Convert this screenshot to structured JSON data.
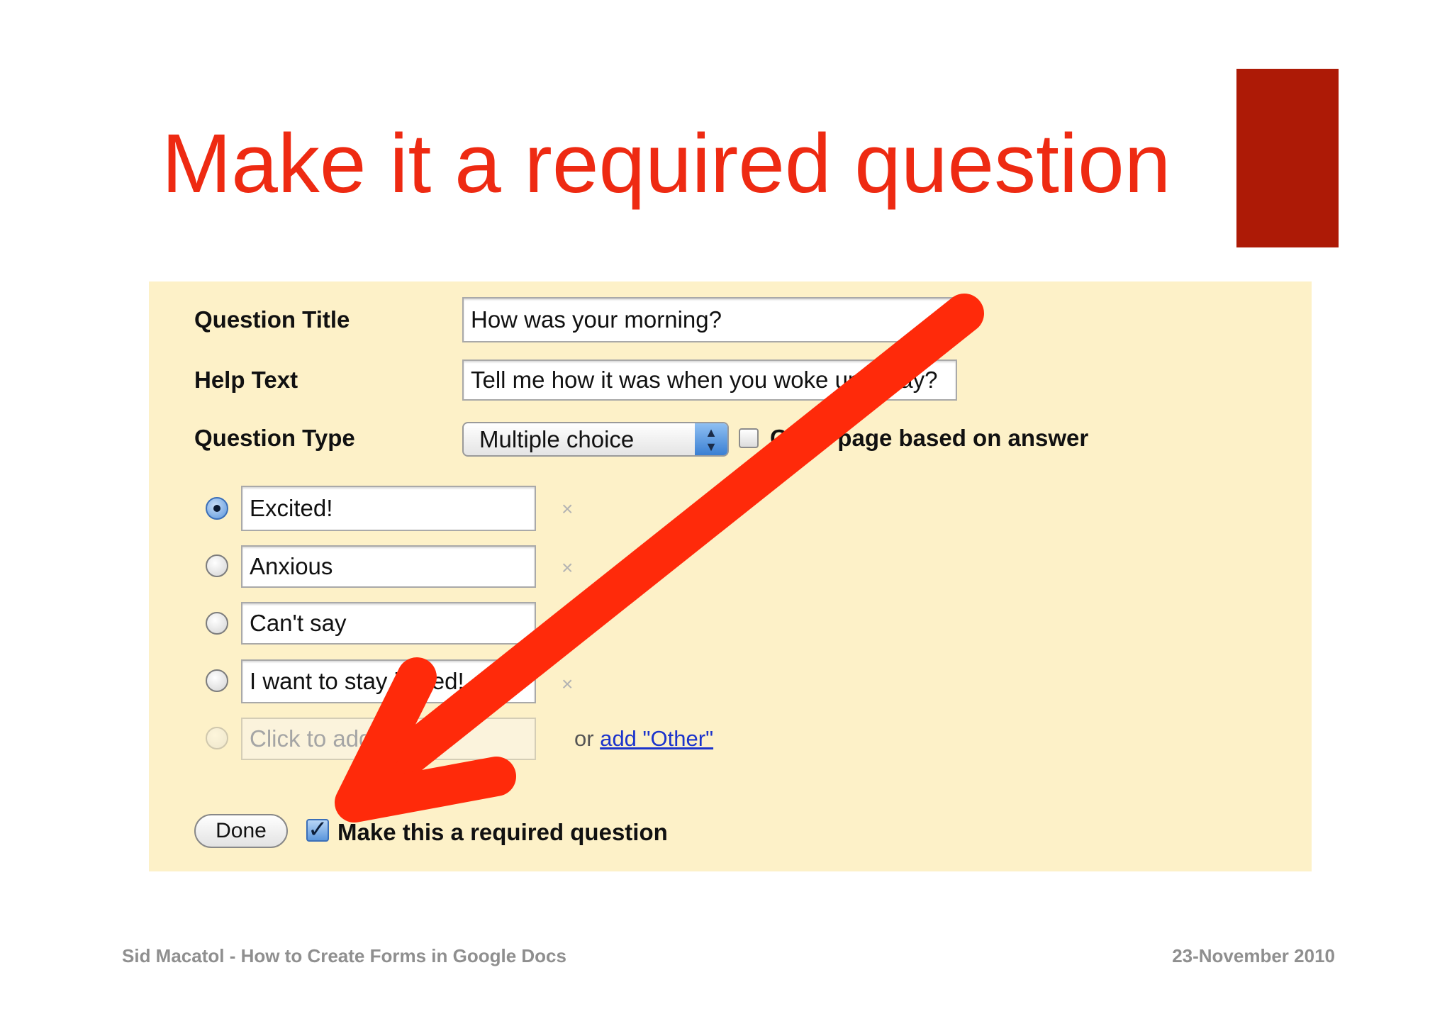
{
  "slide": {
    "title": "Make it a required question",
    "footer_left": "Sid Macatol - How to Create Forms in Google Docs",
    "footer_right": "23-November 2010"
  },
  "form": {
    "question_title_label": "Question Title",
    "question_title_value": "How was your morning?",
    "help_text_label": "Help Text",
    "help_text_value": "Tell me how it was when you woke up today?",
    "question_type_label": "Question Type",
    "question_type_selected": "Multiple choice",
    "go_to_page_label": "Go to page based on answer",
    "options": [
      {
        "value": "Excited!",
        "selected": true
      },
      {
        "value": "Anxious",
        "selected": false
      },
      {
        "value": "Can't say",
        "selected": false
      },
      {
        "value": "I want to stay in bed!",
        "selected": false
      }
    ],
    "add_option_placeholder": "Click to add option",
    "or_text": "or",
    "add_other_link": "add \"Other\"",
    "remove_icon": "×",
    "done_label": "Done",
    "required_label": "Make this a required question",
    "required_checked": true
  },
  "colors": {
    "title": "#ee2a12",
    "accent_block": "#ad1a06",
    "panel_background": "#fdf1c8",
    "annotation_arrow": "#ff2a0a"
  },
  "icons": {
    "select_arrows": "updown-chevron-icon",
    "checkmark": "checkmark-icon",
    "remove": "close-icon",
    "annotation": "arrow-pointer-icon"
  }
}
